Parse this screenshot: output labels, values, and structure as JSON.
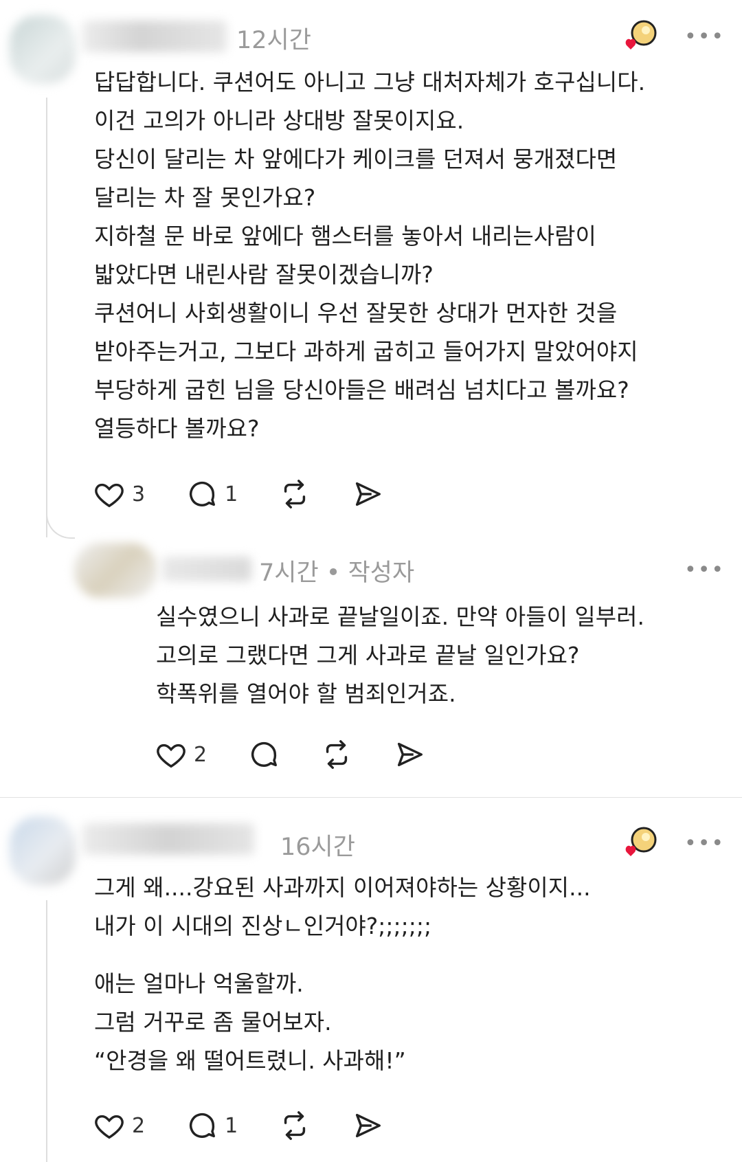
{
  "comments": [
    {
      "time": "12시간",
      "more": "•••",
      "paragraphs": [
        "답답합니다. 쿠션어도 아니고 그냥 대처자체가 호구십니다.\n이건 고의가 아니라 상대방 잘못이지요.\n당신이 달리는 차 앞에다가 케이크를 던져서 뭉개졌다면\n달리는 차 잘 못인가요?\n지하철 문 바로 앞에다 햄스터를 놓아서 내리는사람이\n밟았다면 내린사람 잘못이겠습니까?\n쿠션어니 사회생활이니 우선 잘못한 상대가 먼자한 것을\n받아주는거고, 그보다 과하게 굽히고 들어가지 말았어야지\n부당하게 굽힌 님을 당신아들은 배려심 넘치다고 볼까요?\n열등하다 볼까요?"
      ],
      "likes": "3",
      "replies": "1"
    },
    {
      "time": "7시간 • 작성자",
      "more": "•••",
      "paragraphs": [
        "실수였으니 사과로 끝날일이죠. 만약 아들이 일부러.\n고의로 그랬다면 그게 사과로 끝날 일인가요?\n학폭위를 열어야 할 범죄인거죠."
      ],
      "likes": "2",
      "replies": ""
    },
    {
      "time": "16시간",
      "more": "•••",
      "paragraphs": [
        "그게 왜....강요된 사과까지 이어져야하는 상황이지...\n내가 이 시대의 진상ㄴ인거야?;;;;;;;",
        "애는 얼마나 억울할까.\n그럼 거꾸로 좀 물어보자.\n“안경을 왜 떨어트렸니. 사과해!”"
      ],
      "likes": "2",
      "replies": "1"
    }
  ],
  "colors": {
    "heart_badge": "#e8163c",
    "time_text": "#9a9a9a",
    "body_text": "#1f1f1f"
  },
  "icons": [
    "heart-icon",
    "comment-icon",
    "repost-icon",
    "share-icon",
    "more-icon",
    "liked-by-author-badge"
  ]
}
